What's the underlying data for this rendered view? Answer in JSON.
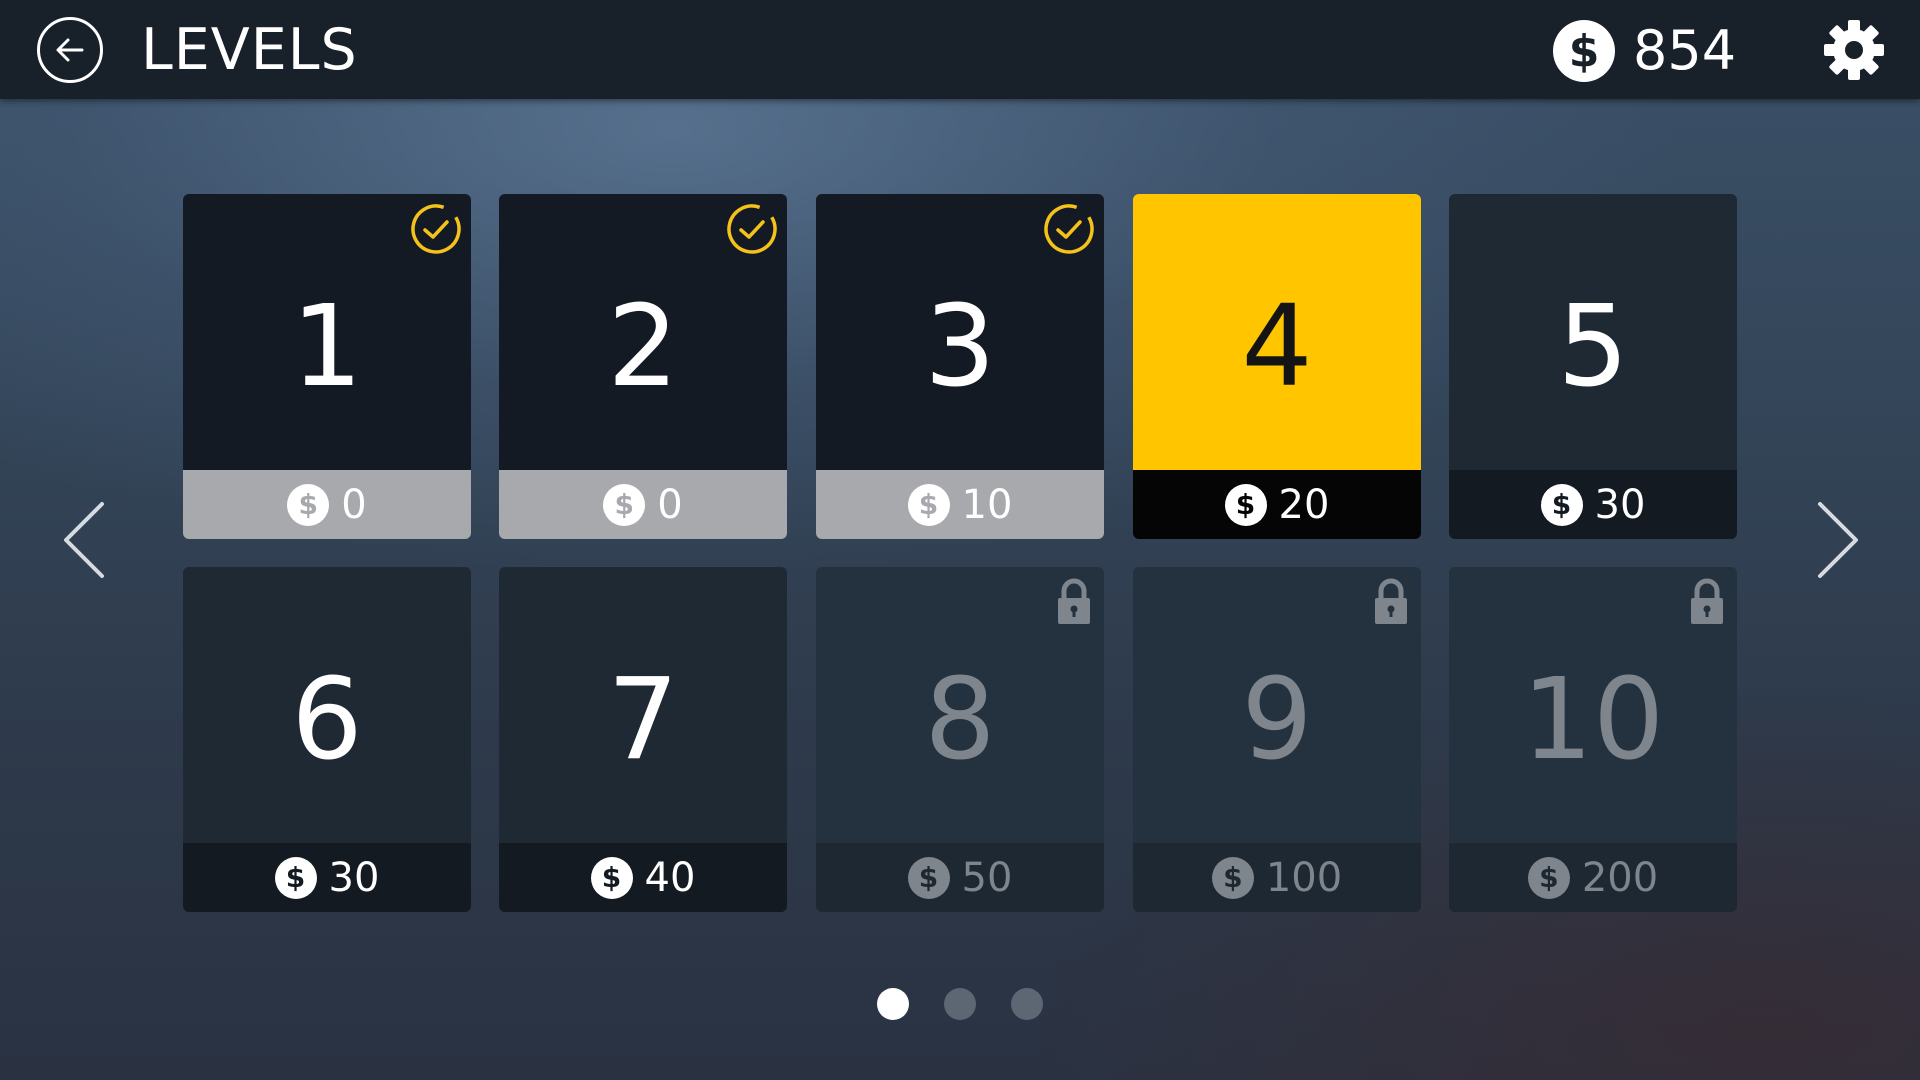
{
  "header": {
    "title": "LEVELS",
    "coin_symbol": "$",
    "coins": "854",
    "back_icon": "back-arrow-icon",
    "settings_icon": "gear-icon"
  },
  "colors": {
    "accent": "#ffc600",
    "completed_badge": "#f5c21a",
    "topbar": "#182029"
  },
  "levels": [
    {
      "number": "1",
      "cost": "0",
      "state": "completed",
      "coin_symbol": "$"
    },
    {
      "number": "2",
      "cost": "0",
      "state": "completed",
      "coin_symbol": "$"
    },
    {
      "number": "3",
      "cost": "10",
      "state": "completed",
      "coin_symbol": "$"
    },
    {
      "number": "4",
      "cost": "20",
      "state": "current",
      "coin_symbol": "$"
    },
    {
      "number": "5",
      "cost": "30",
      "state": "open",
      "coin_symbol": "$"
    },
    {
      "number": "6",
      "cost": "30",
      "state": "open",
      "coin_symbol": "$"
    },
    {
      "number": "7",
      "cost": "40",
      "state": "open",
      "coin_symbol": "$"
    },
    {
      "number": "8",
      "cost": "50",
      "state": "locked",
      "coin_symbol": "$"
    },
    {
      "number": "9",
      "cost": "100",
      "state": "locked",
      "coin_symbol": "$"
    },
    {
      "number": "10",
      "cost": "200",
      "state": "locked",
      "coin_symbol": "$"
    }
  ],
  "pagination": {
    "pages": 3,
    "current_page": 1
  },
  "navigation": {
    "prev_icon": "chevron-left-icon",
    "next_icon": "chevron-right-icon"
  }
}
